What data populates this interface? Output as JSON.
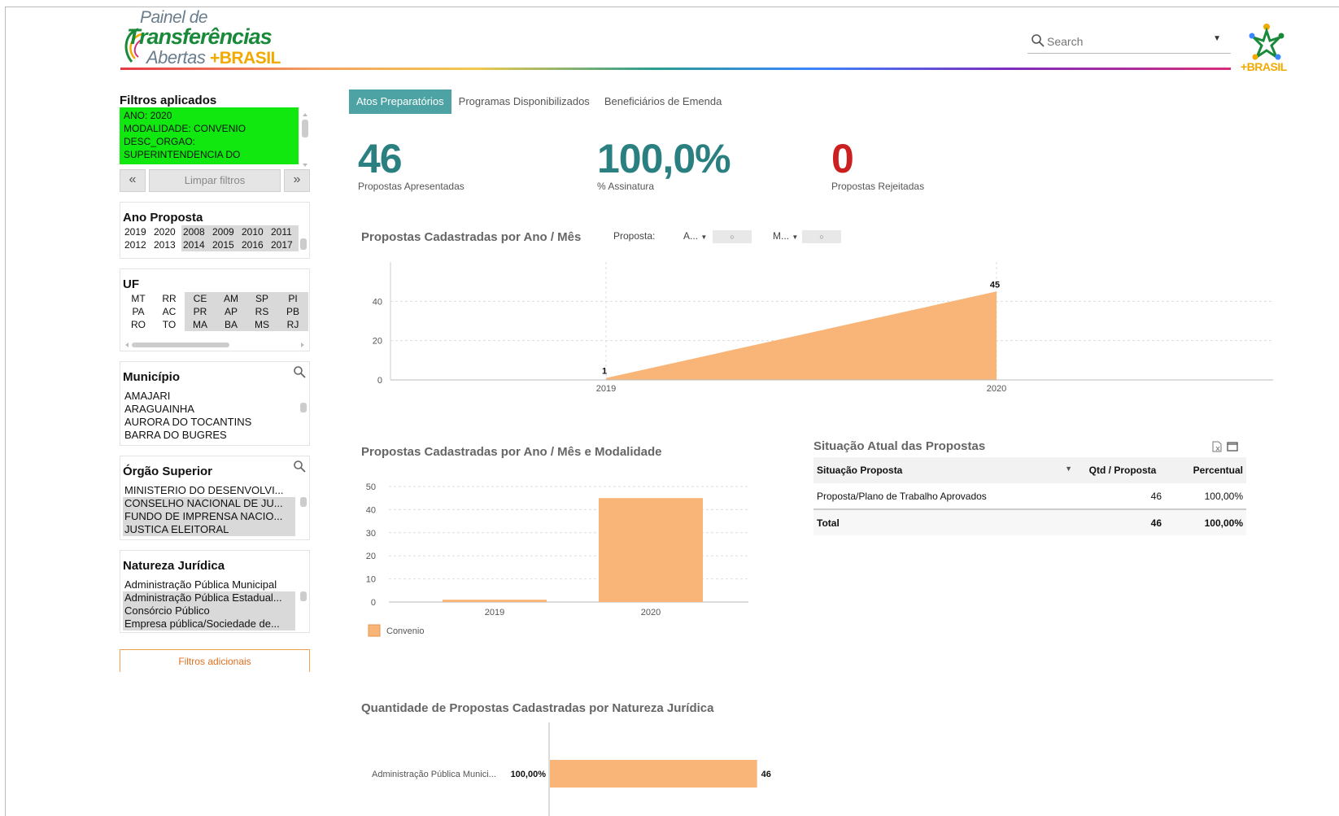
{
  "header": {
    "logo": {
      "line1": "Painel de",
      "line2": "Transferências",
      "line3": "Abertas",
      "line3_brand": "+BRASIL"
    },
    "search_placeholder": "Search",
    "brand_logo_text": "+BRASIL"
  },
  "filters": {
    "applied_title": "Filtros aplicados",
    "applied": [
      "ANO: 2020",
      "MODALIDADE: CONVENIO",
      "DESC_ORGAO:",
      "SUPERINTENDENCIA DO"
    ],
    "prev": "«",
    "clear_label": "Limpar filtros",
    "next": "»",
    "additional_label": "Filtros adicionais"
  },
  "ano_proposta": {
    "title": "Ano Proposta",
    "years": [
      {
        "v": "2019",
        "ex": false
      },
      {
        "v": "2020",
        "ex": false
      },
      {
        "v": "2008",
        "ex": true
      },
      {
        "v": "2009",
        "ex": true
      },
      {
        "v": "2010",
        "ex": true
      },
      {
        "v": "2011",
        "ex": true
      },
      {
        "v": "2012",
        "ex": false
      },
      {
        "v": "2013",
        "ex": false
      },
      {
        "v": "2014",
        "ex": true
      },
      {
        "v": "2015",
        "ex": true
      },
      {
        "v": "2016",
        "ex": true
      },
      {
        "v": "2017",
        "ex": true
      }
    ]
  },
  "uf": {
    "title": "UF",
    "items": [
      {
        "v": "MT",
        "ex": false
      },
      {
        "v": "RR",
        "ex": false
      },
      {
        "v": "CE",
        "ex": true
      },
      {
        "v": "AM",
        "ex": true
      },
      {
        "v": "SP",
        "ex": true
      },
      {
        "v": "PI",
        "ex": true
      },
      {
        "v": "PA",
        "ex": false
      },
      {
        "v": "AC",
        "ex": false
      },
      {
        "v": "PR",
        "ex": true
      },
      {
        "v": "AP",
        "ex": true
      },
      {
        "v": "RS",
        "ex": true
      },
      {
        "v": "PB",
        "ex": true
      },
      {
        "v": "RO",
        "ex": false
      },
      {
        "v": "TO",
        "ex": false
      },
      {
        "v": "MA",
        "ex": true
      },
      {
        "v": "BA",
        "ex": true
      },
      {
        "v": "MS",
        "ex": true
      },
      {
        "v": "RJ",
        "ex": true
      }
    ]
  },
  "municipio": {
    "title": "Município",
    "items": [
      {
        "v": "AMAJARI",
        "ex": false
      },
      {
        "v": "ARAGUAINHA",
        "ex": false
      },
      {
        "v": "AURORA DO TOCANTINS",
        "ex": false
      },
      {
        "v": "BARRA DO BUGRES",
        "ex": false
      }
    ]
  },
  "orgao": {
    "title": "Órgão Superior",
    "items": [
      {
        "v": "MINISTERIO DO DESENVOLVI...",
        "ex": false
      },
      {
        "v": "CONSELHO NACIONAL DE JU...",
        "ex": true
      },
      {
        "v": "FUNDO DE IMPRENSA NACIO...",
        "ex": true
      },
      {
        "v": "JUSTICA ELEITORAL",
        "ex": true
      }
    ]
  },
  "natureza": {
    "title": "Natureza Jurídica",
    "items": [
      {
        "v": "Administração Pública Municipal",
        "ex": false
      },
      {
        "v": "Administração Pública Estadual...",
        "ex": true
      },
      {
        "v": "Consórcio Público",
        "ex": true
      },
      {
        "v": "Empresa pública/Sociedade de...",
        "ex": true
      }
    ]
  },
  "tabs": [
    {
      "label": "Atos Preparatórios",
      "active": true
    },
    {
      "label": "Programas Disponibilizados",
      "active": false
    },
    {
      "label": "Beneficiários de Emenda",
      "active": false
    }
  ],
  "kpis": [
    {
      "value": "46",
      "label": "Propostas Apresentadas",
      "color": "#2a7f80"
    },
    {
      "value": "100,0%",
      "label": "% Assinatura",
      "color": "#2a7f80"
    },
    {
      "value": "0",
      "label": "Propostas Rejeitadas",
      "color": "#cc1f1f"
    }
  ],
  "chart1_header": {
    "title": "Propostas Cadastradas por Ano / Mês",
    "filter_label": "Proposta:",
    "sel1": "A...",
    "sel2": "M..."
  },
  "chart2_title": "Propostas Cadastradas por Ano / Mês e Modalidade",
  "chart3_title": "Quantidade de Propostas Cadastradas por Natureza Jurídica",
  "chart_data": [
    {
      "type": "area",
      "x": [
        "2019",
        "2020"
      ],
      "series": [
        {
          "values": [
            1,
            45
          ]
        }
      ],
      "data_labels": [
        "1",
        "45"
      ],
      "yticks": [
        0,
        20,
        40
      ],
      "ylim": [
        0,
        60
      ],
      "grid": true,
      "color": "#f8b577"
    },
    {
      "type": "bar",
      "categories": [
        "2019",
        "2020"
      ],
      "series": [
        {
          "name": "Convenio",
          "values": [
            1,
            45
          ]
        }
      ],
      "yticks": [
        0,
        10,
        20,
        30,
        40,
        50
      ],
      "ylim": [
        0,
        50
      ],
      "grid": true,
      "legend": "bottom-left",
      "color": "#f8b577"
    },
    {
      "type": "bar",
      "orientation": "horizontal",
      "categories": [
        "Administração Pública Munici..."
      ],
      "category_pct": [
        "100,00%"
      ],
      "values": [
        46
      ],
      "data_labels": [
        "46"
      ],
      "color": "#f8b577"
    }
  ],
  "situacao": {
    "title": "Situação Atual das Propostas",
    "headers": [
      "Situação Proposta",
      "Qtd / Proposta",
      "Percentual"
    ],
    "rows": [
      [
        "Proposta/Plano de Trabalho Aprovados",
        "46",
        "100,00%"
      ]
    ],
    "total": [
      "Total",
      "46",
      "100,00%"
    ]
  }
}
